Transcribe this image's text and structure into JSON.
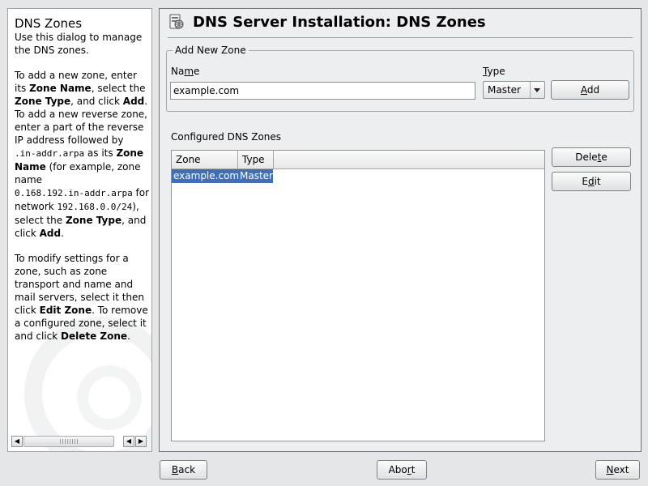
{
  "help": {
    "title": "DNS Zones",
    "p1": "Use this dialog to manage the DNS zones.",
    "p2": {
      "t1": "To add a new zone, enter its ",
      "b1": "Zone Name",
      "t2": ", select the ",
      "b2": "Zone Type",
      "t3": ", and click ",
      "b3": "Add",
      "t4": ". To add a new reverse zone, enter a part of the reverse IP address followed by ",
      "m1": ".in-addr.arpa",
      "t5": " as its ",
      "b4": "Zone Name",
      "t6": " (for example, zone name ",
      "m2": "0.168.192.in-addr.arpa",
      "t7": " for network ",
      "m3": "192.168.0.0/24",
      "t8": "), select the ",
      "b5": "Zone Type",
      "t9": ", and click ",
      "b6": "Add",
      "t10": "."
    },
    "p3": {
      "t1": "To modify settings for a zone, such as zone transport and name and mail servers, select it then click ",
      "b1": "Edit Zone",
      "t2": ". To remove a configured zone, select it and click ",
      "b2": "Delete Zone",
      "t3": "."
    }
  },
  "main": {
    "title": "DNS Server Installation: DNS Zones",
    "add_zone": {
      "legend": "Add New Zone",
      "name_label": {
        "pre": "Na",
        "mnemonic": "m",
        "post": "e"
      },
      "name_value": "example.com",
      "type_label": {
        "pre": "",
        "mnemonic": "T",
        "post": "ype"
      },
      "type_value": "Master",
      "add_button": {
        "pre": "",
        "mnemonic": "A",
        "post": "dd"
      }
    },
    "configured_label": "Configured DNS Zones",
    "table": {
      "columns": [
        "Zone",
        "Type"
      ],
      "rows": [
        {
          "zone": "example.com",
          "type": "Master"
        }
      ]
    },
    "delete_button": {
      "pre": "Dele",
      "mnemonic": "t",
      "post": "e"
    },
    "edit_button": {
      "pre": "E",
      "mnemonic": "d",
      "post": "it"
    }
  },
  "footer": {
    "back": {
      "pre": "",
      "mnemonic": "B",
      "post": "ack"
    },
    "abort": {
      "pre": "Abo",
      "mnemonic": "r",
      "post": "t"
    },
    "next": {
      "pre": "",
      "mnemonic": "N",
      "post": "ext"
    }
  },
  "icons": {
    "title_icon": "dns-server-icon"
  }
}
